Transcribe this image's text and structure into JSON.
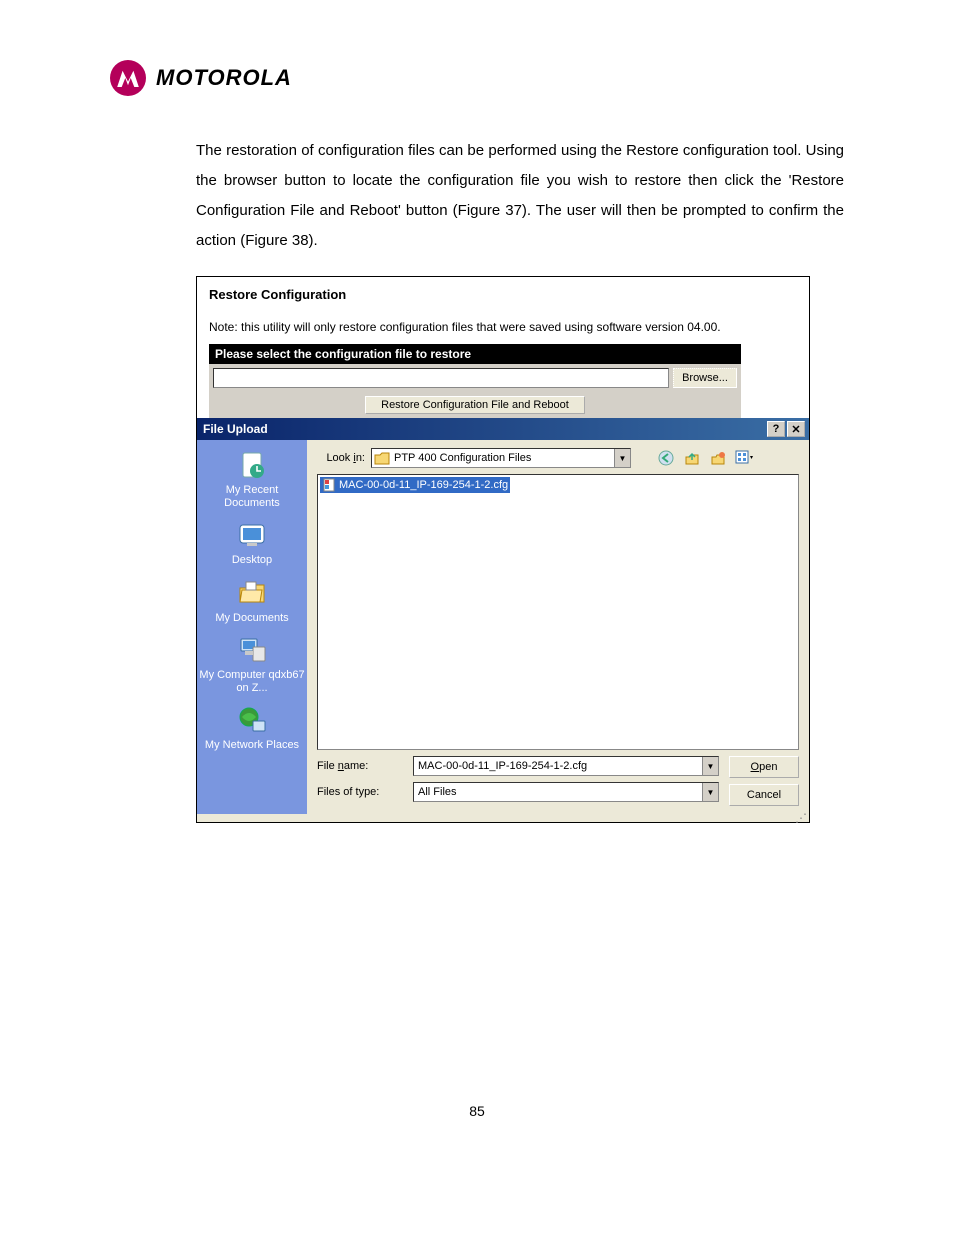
{
  "brand": "MOTOROLA",
  "body_text": "The restoration of configuration files can be performed using the Restore configuration tool. Using the browser button to locate the configuration file you wish to restore then click the 'Restore Configuration File and Reboot' button (Figure 37). The user will then be prompted to confirm the action (Figure 38).",
  "restore": {
    "title": "Restore Configuration",
    "note": "Note: this utility will only restore configuration files that were saved using software version  04.00.",
    "blackbar": "Please select the configuration file to restore",
    "browse": "Browse...",
    "restore_btn": "Restore Configuration File and Reboot"
  },
  "dialog": {
    "title": "File Upload",
    "lookin_label": "Look in:",
    "lookin_value": "PTP 400 Configuration Files",
    "places": [
      {
        "label": "My Recent Documents"
      },
      {
        "label": "Desktop"
      },
      {
        "label": "My Documents"
      },
      {
        "label": "My Computer qdxb67 on Z..."
      },
      {
        "label": "My Network Places"
      }
    ],
    "file_selected": "MAC-00-0d-11_IP-169-254-1-2.cfg",
    "filename_label": "File name:",
    "filename_value": "MAC-00-0d-11_IP-169-254-1-2.cfg",
    "filetype_label": "Files of type:",
    "filetype_value": "All Files",
    "open": "Open",
    "cancel": "Cancel"
  },
  "page_number": "85"
}
